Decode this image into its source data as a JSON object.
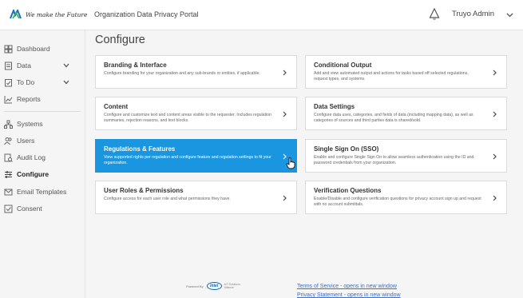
{
  "header": {
    "logo_text": "We make the Future",
    "portal_title": "Organization Data Privacy Portal",
    "user_name": "Truyo Admin",
    "brand_color": "#1a95e0"
  },
  "sidebar": {
    "items": [
      {
        "label": "Dashboard",
        "icon": "grid-icon"
      },
      {
        "label": "Data",
        "icon": "data-icon",
        "expandable": true
      },
      {
        "label": "To Do",
        "icon": "todo-icon",
        "expandable": true
      },
      {
        "label": "Reports",
        "icon": "chart-icon"
      },
      {
        "label": "Systems",
        "icon": "systems-icon"
      },
      {
        "label": "Users",
        "icon": "users-icon"
      },
      {
        "label": "Audit Log",
        "icon": "audit-icon"
      },
      {
        "label": "Configure",
        "icon": "sliders-icon",
        "active": true
      },
      {
        "label": "Email Templates",
        "icon": "mail-icon"
      },
      {
        "label": "Consent",
        "icon": "checkbox-icon"
      }
    ]
  },
  "main": {
    "title": "Configure",
    "cards": [
      {
        "title": "Branding & Interface",
        "desc": "Configure branding for your organization and any sub-brands or entities, if applicable."
      },
      {
        "title": "Conditional Output",
        "desc": "Add and view automated output and actions for tasks based off selected regulations, request types, and systems."
      },
      {
        "title": "Content",
        "desc": "Configure and customize text and content areas visible to the requester. Includes regulation summaries, rejection reasons, and text blocks."
      },
      {
        "title": "Data Settings",
        "desc": "Configure data uses, categories, and fields of data (including mapping data), as well as categories of sources and third parties data is shared/sold."
      },
      {
        "title": "Regulations & Features",
        "desc": "View supported rights per regulation and configure feature and regulation settings to fit your organization.",
        "selected": true
      },
      {
        "title": "Single Sign On (SSO)",
        "desc": "Enable and configure Single Sign On to allow seamless authentication using the ID and password credentials from your organization."
      },
      {
        "title": "User Roles & Permissions",
        "desc": "Configure access for each user role and what permissions they have."
      },
      {
        "title": "Verification Questions",
        "desc": "Enable/Disable and configure verification questions for privacy account sign up and request with no account submittals."
      }
    ]
  },
  "footer": {
    "powered_by": "Powered By",
    "intel": "intel",
    "alliance": "IoT Solutions Alliance",
    "tos_link": "Terms of Service - opens in new window",
    "privacy_link": "Privacy Statement - opens in new window"
  }
}
